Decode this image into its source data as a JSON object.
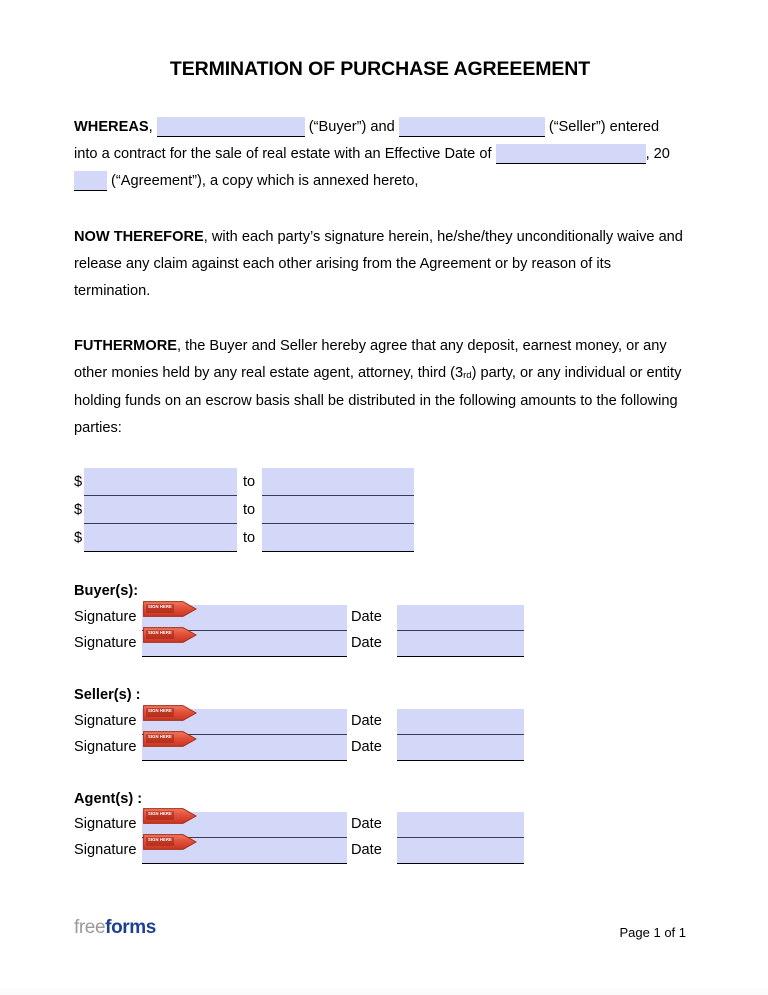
{
  "document": {
    "title": "TERMINATION OF PURCHASE AGREEEMENT"
  },
  "paragraphs": {
    "whereas": {
      "lead": "WHEREAS",
      "after_lead": ", ",
      "buyer_suffix": " (“Buyer”) and ",
      "seller_suffix": " (“Seller”) entered into a contract for the sale of real estate with an Effective Date of ",
      "effdate_suffix": ", 20",
      "year_suffix": " (“Agreement”), a copy which is annexed hereto,"
    },
    "now_therefore": {
      "lead": "NOW THEREFORE",
      "body": ", with each party’s signature herein, he/she/they unconditionally waive and release any claim against each other arising from the Agreement or by reason of its termination."
    },
    "futhermore": {
      "lead": "FUTHERMORE",
      "body_part1": ", the Buyer and Seller hereby agree that any deposit, earnest money, or any other monies held by any real estate agent, attorney, third (3",
      "ordinal": "rd",
      "body_part2": ") party, or any individual or entity holding funds on an escrow basis shall be distributed in the following amounts to the following parties:"
    }
  },
  "amounts": {
    "dollar_sign": "$",
    "to_label": "to",
    "rows": [
      {
        "amount": "",
        "party": ""
      },
      {
        "amount": "",
        "party": ""
      },
      {
        "amount": "",
        "party": ""
      }
    ]
  },
  "signature_sections": [
    {
      "heading": "Buyer(s):",
      "rows": [
        {
          "signature_label": "Signature",
          "signature_value": "",
          "date_label": "Date",
          "date_value": "",
          "tag": "SIGN HERE"
        },
        {
          "signature_label": "Signature",
          "signature_value": "",
          "date_label": "Date",
          "date_value": "",
          "tag": "SIGN HERE"
        }
      ]
    },
    {
      "heading": "Seller(s) :",
      "rows": [
        {
          "signature_label": "Signature",
          "signature_value": "",
          "date_label": "Date",
          "date_value": "",
          "tag": "SIGN HERE"
        },
        {
          "signature_label": "Signature",
          "signature_value": "",
          "date_label": "Date",
          "date_value": "",
          "tag": "SIGN HERE"
        }
      ]
    },
    {
      "heading": "Agent(s) :",
      "rows": [
        {
          "signature_label": "Signature",
          "signature_value": "",
          "date_label": "Date",
          "date_value": "",
          "tag": "SIGN HERE"
        },
        {
          "signature_label": "Signature",
          "signature_value": "",
          "date_label": "Date",
          "date_value": "",
          "tag": "SIGN HERE"
        }
      ]
    }
  ],
  "footer": {
    "logo_part1": "free",
    "logo_part2": "forms",
    "page_number": "Page 1 of 1"
  },
  "colors": {
    "field_fill": "#d3d8f8",
    "field_rule": "#000000",
    "tag_red": "#e04a32",
    "logo_gray": "#9a9a9a",
    "logo_blue": "#1f3f94"
  }
}
